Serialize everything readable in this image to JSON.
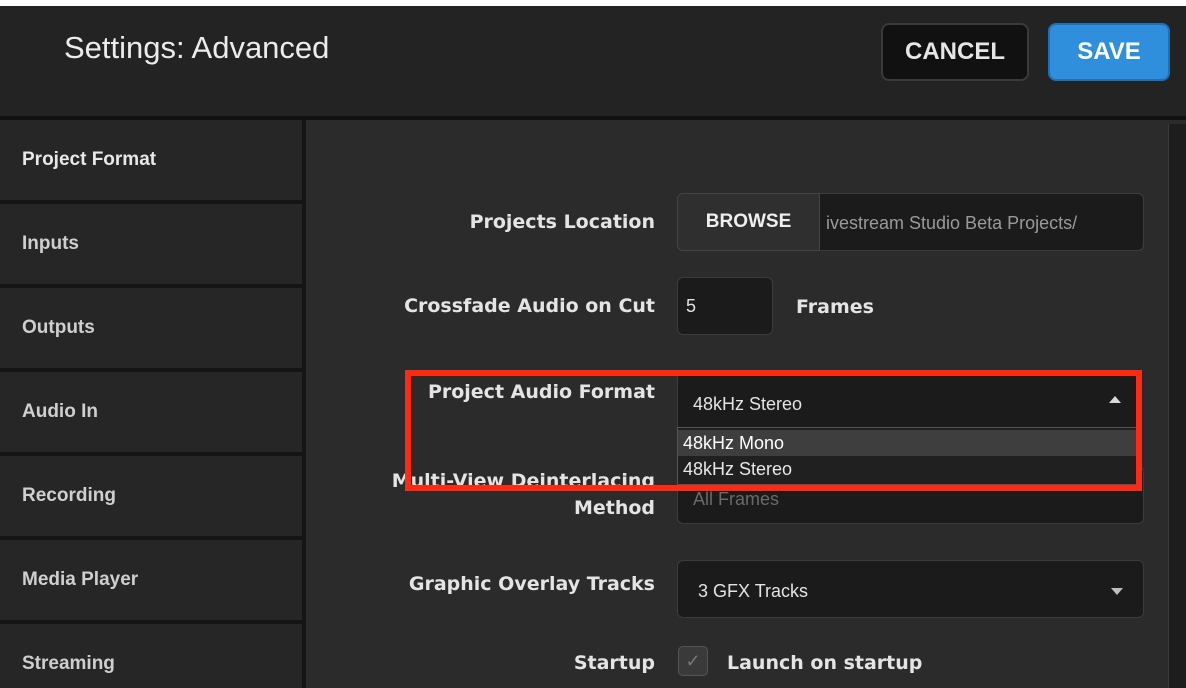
{
  "header": {
    "title": "Settings: Advanced",
    "cancel_label": "CANCEL",
    "save_label": "SAVE"
  },
  "sidebar": {
    "items": [
      {
        "label": "Project Format"
      },
      {
        "label": "Inputs"
      },
      {
        "label": "Outputs"
      },
      {
        "label": "Audio In"
      },
      {
        "label": "Recording"
      },
      {
        "label": "Media Player"
      },
      {
        "label": "Streaming"
      }
    ]
  },
  "settings": {
    "projects_location": {
      "label": "Projects Location",
      "browse_label": "BROWSE",
      "path": "ivestream Studio Beta Projects/"
    },
    "crossfade": {
      "label": "Crossfade Audio on Cut",
      "value": "5",
      "unit": "Frames"
    },
    "audio_format": {
      "label": "Project Audio Format",
      "selected": "48kHz Stereo",
      "options": [
        "48kHz Mono",
        "48kHz Stereo"
      ]
    },
    "deinterlacing": {
      "label_line1": "Multi-View Deinterlacing",
      "label_line2": "Method",
      "selected": "All Frames"
    },
    "overlay_tracks": {
      "label": "Graphic Overlay Tracks",
      "selected": "3 GFX Tracks"
    },
    "startup": {
      "label": "Startup",
      "checkbox_label": "Launch on startup",
      "checked": true
    }
  },
  "colors": {
    "accent": "#2f8fdc",
    "highlight_box": "#ff2a12",
    "background": "#2b2b2b"
  }
}
